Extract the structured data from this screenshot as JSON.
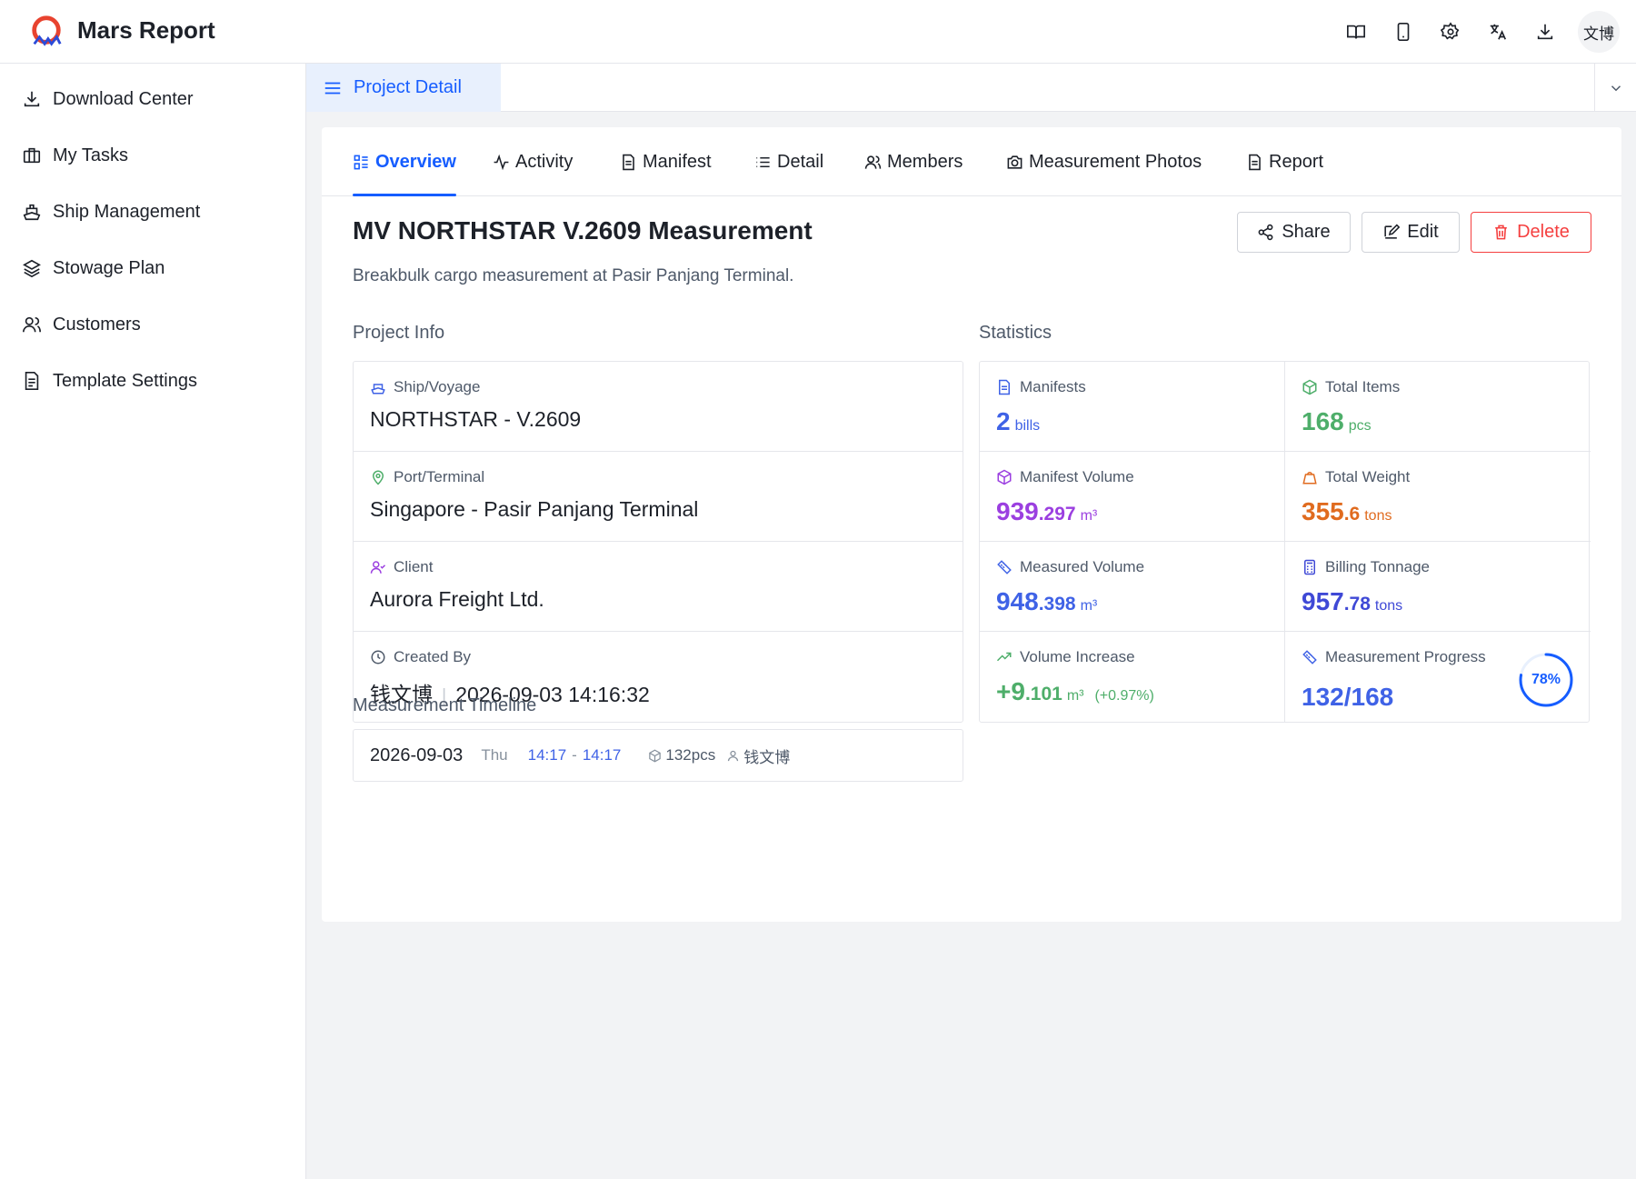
{
  "app": {
    "title": "Mars Report",
    "avatar_text": "文博"
  },
  "sidebar": {
    "items": [
      {
        "label": "Download Center",
        "icon": "download-icon"
      },
      {
        "label": "My Tasks",
        "icon": "briefcase-icon"
      },
      {
        "label": "Ship Management",
        "icon": "ship-icon"
      },
      {
        "label": "Stowage Plan",
        "icon": "layers-icon"
      },
      {
        "label": "Customers",
        "icon": "users-icon"
      },
      {
        "label": "Template Settings",
        "icon": "document-icon"
      }
    ]
  },
  "tabbar": {
    "active_tab": "Project Detail"
  },
  "subtabs": [
    {
      "label": "Overview",
      "icon": "grid-list-icon",
      "active": true
    },
    {
      "label": "Activity",
      "icon": "activity-icon"
    },
    {
      "label": "Manifest",
      "icon": "document-icon"
    },
    {
      "label": "Detail",
      "icon": "list-icon"
    },
    {
      "label": "Members",
      "icon": "users-icon"
    },
    {
      "label": "Measurement Photos",
      "icon": "camera-icon"
    },
    {
      "label": "Report",
      "icon": "document-icon"
    }
  ],
  "project": {
    "title": "MV NORTHSTAR V.2609 Measurement",
    "description": "Breakbulk cargo measurement at Pasir Panjang Terminal."
  },
  "actions": {
    "share": "Share",
    "edit": "Edit",
    "delete": "Delete"
  },
  "sections": {
    "info": "Project Info",
    "stats": "Statistics",
    "timeline": "Measurement Timeline"
  },
  "info": {
    "ship_label": "Ship/Voyage",
    "ship_value": "NORTHSTAR - V.2609",
    "port_label": "Port/Terminal",
    "port_value": "Singapore - Pasir Panjang Terminal",
    "client_label": "Client",
    "client_value": "Aurora Freight Ltd.",
    "created_label": "Created By",
    "created_by": "钱文博",
    "created_at": "2026-09-03 14:16:32"
  },
  "stats": {
    "manifests": {
      "label": "Manifests",
      "value": "2",
      "unit": "bills"
    },
    "total_items": {
      "label": "Total Items",
      "value": "168",
      "unit": "pcs"
    },
    "manifest_volume": {
      "label": "Manifest Volume",
      "int": "939",
      "dec": ".297",
      "unit": "m³"
    },
    "total_weight": {
      "label": "Total Weight",
      "int": "355",
      "dec": ".6",
      "unit": "tons"
    },
    "measured_volume": {
      "label": "Measured Volume",
      "int": "948",
      "dec": ".398",
      "unit": "m³"
    },
    "billing_tonnage": {
      "label": "Billing Tonnage",
      "int": "957",
      "dec": ".78",
      "unit": "tons"
    },
    "volume_increase": {
      "label": "Volume Increase",
      "int": "+9",
      "dec": ".101",
      "unit": "m³",
      "pct": "(+0.97%)"
    },
    "progress": {
      "label": "Measurement Progress",
      "value": "132/168",
      "percent_text": "78%",
      "fraction": 0.78
    }
  },
  "timeline": [
    {
      "date": "2026-09-03",
      "day": "Thu",
      "start": "14:17",
      "end": "14:17",
      "count": "132pcs",
      "user": "钱文博"
    }
  ],
  "colors": {
    "accent": "#165dff",
    "danger": "#f53f3f"
  }
}
